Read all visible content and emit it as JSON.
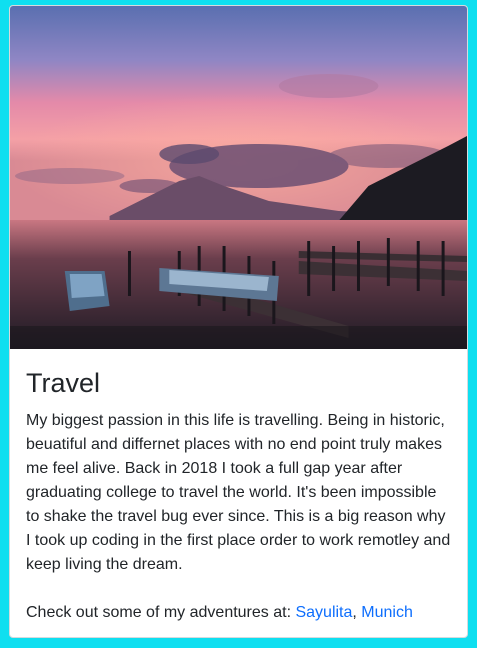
{
  "card": {
    "image_alt": "Sunset over lake with docks and boats",
    "title": "Travel",
    "paragraph": "My biggest passion in this life is travelling. Being in historic, beuatiful and differnet places with no end point truly makes me feel alive. Back in 2018 I took a full gap year after graduating college to travel the world. It's been impossible to shake the travel bug ever since. This is a big reason why I took up coding in the first place order to work remotley and keep living the dream.",
    "links_prefix": "Check out some of my adventures at: ",
    "links": [
      {
        "label": "Sayulita"
      },
      {
        "label": "Munich"
      }
    ],
    "link_separator": ", "
  },
  "colors": {
    "page_background": "#0fdff0",
    "link": "#0d6efd",
    "text": "#212529"
  }
}
